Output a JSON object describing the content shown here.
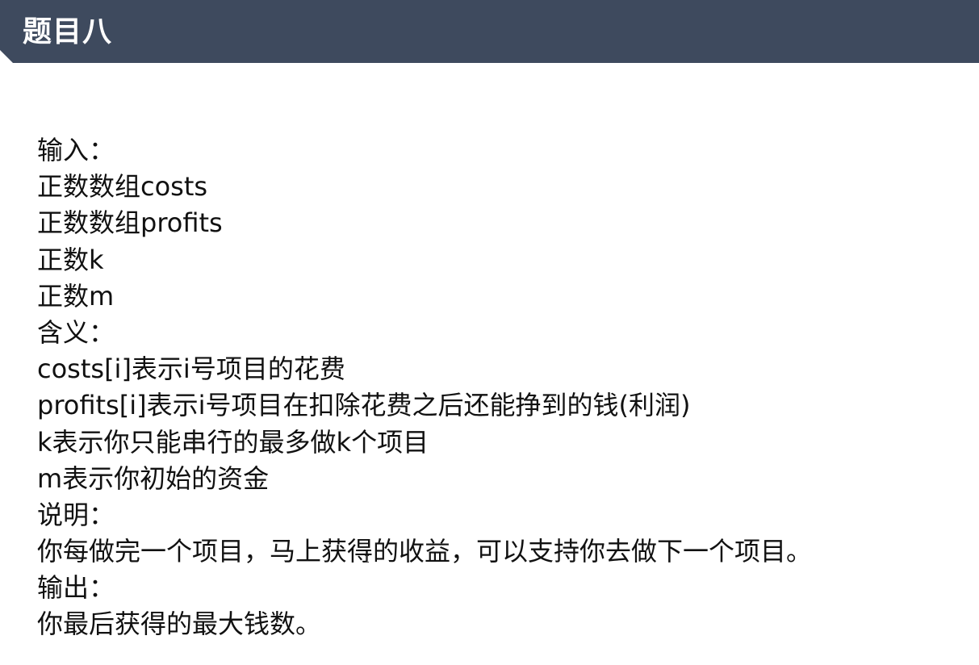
{
  "header": {
    "title": "题目八"
  },
  "content": {
    "lines": [
      "输入：",
      "正数数组costs",
      "正数数组profits",
      "正数k",
      "正数m",
      "含义：",
      "costs[i]表示i号项目的花费",
      "profits[i]表示i号项目在扣除花费之后还能挣到的钱(利润)",
      "k表示你只能串行的最多做k个项目",
      "m表示你初始的资金",
      "说明：",
      "你每做完一个项目，马上获得的收益，可以支持你去做下一个项目。",
      "输出：",
      "你最后获得的最大钱数。"
    ]
  },
  "colors": {
    "header_bg": "#3e4a5e",
    "header_text": "#ffffff",
    "body_text": "#111111",
    "page_bg": "#ffffff"
  },
  "icons": {
    "pointer": "mouse-pointer-icon",
    "text_cursor": "i-beam"
  }
}
